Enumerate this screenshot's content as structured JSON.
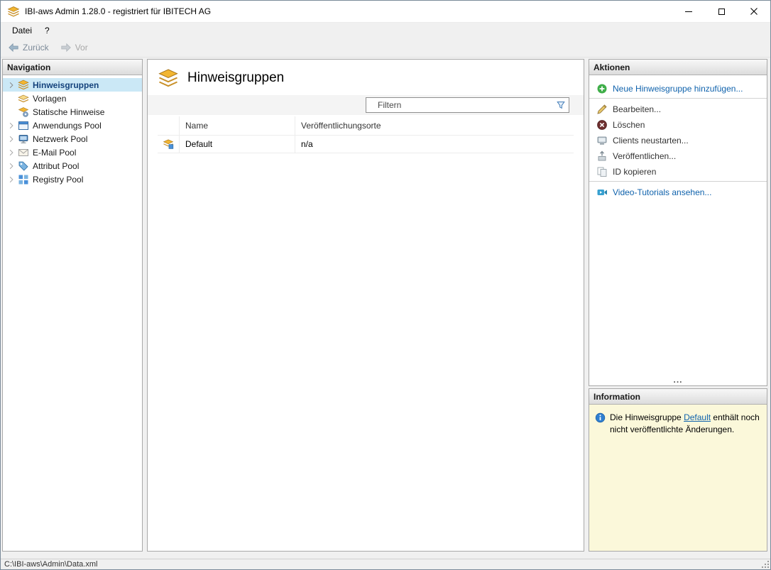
{
  "colors": {
    "accent_link": "#0f62ac",
    "selection_bg": "#cbe8f6",
    "info_bg": "#fbf8da",
    "panel_header_gradient_from": "#f8f8f8",
    "panel_header_gradient_to": "#dcdcdc"
  },
  "window": {
    "title": "IBI-aws Admin 1.28.0 - registriert für IBITECH AG"
  },
  "menubar": {
    "items": [
      {
        "label": "Datei"
      },
      {
        "label": "?"
      }
    ]
  },
  "toolbar": {
    "back": "Zurück",
    "forward": "Vor"
  },
  "navigation": {
    "header": "Navigation",
    "items": [
      {
        "label": "Hinweisgruppen",
        "icon": "hinweisgruppen-layers-icon",
        "expandable": true,
        "selected": true
      },
      {
        "label": "Vorlagen",
        "icon": "vorlagen-icon",
        "expandable": false,
        "selected": false
      },
      {
        "label": "Statische Hinweise",
        "icon": "statische-hinweise-icon",
        "expandable": false,
        "selected": false
      },
      {
        "label": "Anwendungs Pool",
        "icon": "anwendungs-pool-icon",
        "expandable": true,
        "selected": false
      },
      {
        "label": "Netzwerk Pool",
        "icon": "netzwerk-pool-icon",
        "expandable": true,
        "selected": false
      },
      {
        "label": "E-Mail Pool",
        "icon": "email-pool-icon",
        "expandable": true,
        "selected": false
      },
      {
        "label": "Attribut Pool",
        "icon": "attribut-pool-icon",
        "expandable": true,
        "selected": false
      },
      {
        "label": "Registry Pool",
        "icon": "registry-pool-icon",
        "expandable": true,
        "selected": false
      }
    ]
  },
  "main": {
    "title": "Hinweisgruppen",
    "filter_placeholder": "Filtern",
    "table": {
      "columns": [
        "Name",
        "Veröffentlichungsorte"
      ],
      "rows": [
        {
          "name": "Default",
          "veroeffentlichungsorte": "n/a"
        }
      ]
    }
  },
  "actions": {
    "header": "Aktionen",
    "items": [
      {
        "label": "Neue Hinweisgruppe hinzufügen...",
        "icon": "add-icon",
        "link": true
      },
      {
        "label": "Bearbeiten...",
        "icon": "edit-pencil-icon",
        "link": false
      },
      {
        "label": "Löschen",
        "icon": "delete-icon",
        "link": false
      },
      {
        "label": "Clients neustarten...",
        "icon": "restart-clients-icon",
        "link": false
      },
      {
        "label": "Veröffentlichen...",
        "icon": "publish-icon",
        "link": false
      },
      {
        "label": "ID kopieren",
        "icon": "copy-id-icon",
        "link": false
      },
      {
        "label": "Video-Tutorials ansehen...",
        "icon": "video-tutorials-icon",
        "link": true
      }
    ],
    "more_label": "..."
  },
  "information": {
    "header": "Information",
    "message_start": "Die Hinweisgruppe ",
    "link_text": "Default",
    "message_end": " enthält noch nicht veröffentlichte Änderungen."
  },
  "statusbar": {
    "path": "C:\\IBI-aws\\Admin\\Data.xml"
  }
}
